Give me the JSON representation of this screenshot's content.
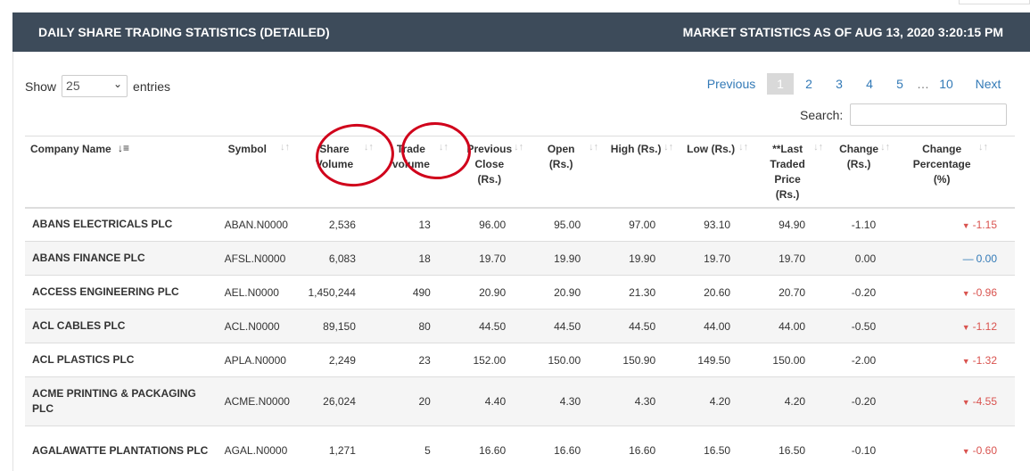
{
  "header": {
    "title": "DAILY SHARE TRADING STATISTICS (DETAILED)",
    "market_stats": "MARKET STATISTICS AS OF  AUG 13, 2020 3:20:15 PM"
  },
  "length": {
    "show": "Show",
    "value": "25",
    "entries": "entries"
  },
  "pagination": {
    "previous": "Previous",
    "current": "1",
    "pages": [
      "2",
      "3",
      "4",
      "5"
    ],
    "ellipsis": "…",
    "last": "10",
    "next": "Next"
  },
  "search": {
    "label": "Search:",
    "placeholder": ""
  },
  "columns": [
    "Company Name",
    "Symbol",
    "Share Volume",
    "Trade volume",
    "Previous Close (Rs.)",
    "Open (Rs.)",
    "High (Rs.)",
    "Low (Rs.)",
    "**Last Traded Price (Rs.)",
    "Change (Rs.)",
    "Change Percentage (%)"
  ],
  "rows": [
    [
      "ABANS ELECTRICALS PLC",
      "ABAN.N0000",
      "2,536",
      "13",
      "96.00",
      "95.00",
      "97.00",
      "93.10",
      "94.90",
      "-1.10",
      "-1.15"
    ],
    [
      "ABANS FINANCE PLC",
      "AFSL.N0000",
      "6,083",
      "18",
      "19.70",
      "19.90",
      "19.90",
      "19.70",
      "19.70",
      "0.00",
      "0.00"
    ],
    [
      "ACCESS ENGINEERING PLC",
      "AEL.N0000",
      "1,450,244",
      "490",
      "20.90",
      "20.90",
      "21.30",
      "20.60",
      "20.70",
      "-0.20",
      "-0.96"
    ],
    [
      "ACL CABLES PLC",
      "ACL.N0000",
      "89,150",
      "80",
      "44.50",
      "44.50",
      "44.50",
      "44.00",
      "44.00",
      "-0.50",
      "-1.12"
    ],
    [
      "ACL PLASTICS PLC",
      "APLA.N0000",
      "2,249",
      "23",
      "152.00",
      "150.00",
      "150.90",
      "149.50",
      "150.00",
      "-2.00",
      "-1.32"
    ],
    [
      "ACME PRINTING & PACKAGING PLC",
      "ACME.N0000",
      "26,024",
      "20",
      "4.40",
      "4.30",
      "4.30",
      "4.20",
      "4.20",
      "-0.20",
      "-4.55"
    ],
    [
      "AGALAWATTE PLANTATIONS PLC",
      "AGAL.N0000",
      "1,271",
      "5",
      "16.60",
      "16.60",
      "16.60",
      "16.50",
      "16.50",
      "-0.10",
      "-0.60"
    ]
  ],
  "colors": {
    "header_bar": "#3d4b5a",
    "link": "#337ab7",
    "negative": "#d9534f",
    "annotation": "#d0021b"
  }
}
